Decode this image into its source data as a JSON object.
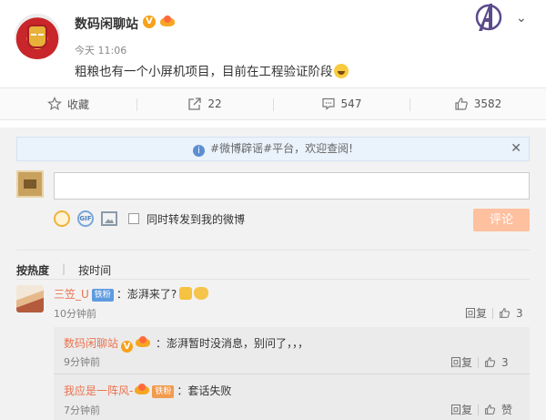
{
  "post": {
    "author": "数码闲聊站",
    "verified_mark": "V",
    "time": "今天 11:06",
    "content": "粗粮也有一个小屏机项目，目前在工程验证阶段"
  },
  "actions": {
    "favorite": "收藏",
    "repost": "22",
    "comment": "547",
    "like": "3582"
  },
  "notice": {
    "text": "#微博辟谣#平台，欢迎查阅!",
    "close": "✕"
  },
  "composer": {
    "placeholder": "",
    "gif": "GIF",
    "forward_label": "同时转发到我的微博",
    "submit": "评论"
  },
  "sort": {
    "hot": "按热度",
    "time": "按时间"
  },
  "comments": [
    {
      "user": "三笠_U",
      "badge": "铁粉",
      "text": "：澎湃来了?",
      "time": "10分钟前",
      "reply": "回复",
      "likes": "3"
    }
  ],
  "replies": [
    {
      "user": "数码闲聊站",
      "verified_mark": "V",
      "text": "：澎湃暂时没消息，别问了，，，",
      "time": "9分钟前",
      "reply": "回复",
      "likes": "3"
    },
    {
      "user": "我应是一阵风-",
      "badge": "铁粉",
      "text": "：套话失败",
      "time": "7分钟前",
      "reply": "回复",
      "likes": "赞"
    }
  ],
  "colors": {
    "accent": "#eb7350",
    "submit_bg": "#ffc09f",
    "notice_bg": "#eaf2fb"
  }
}
